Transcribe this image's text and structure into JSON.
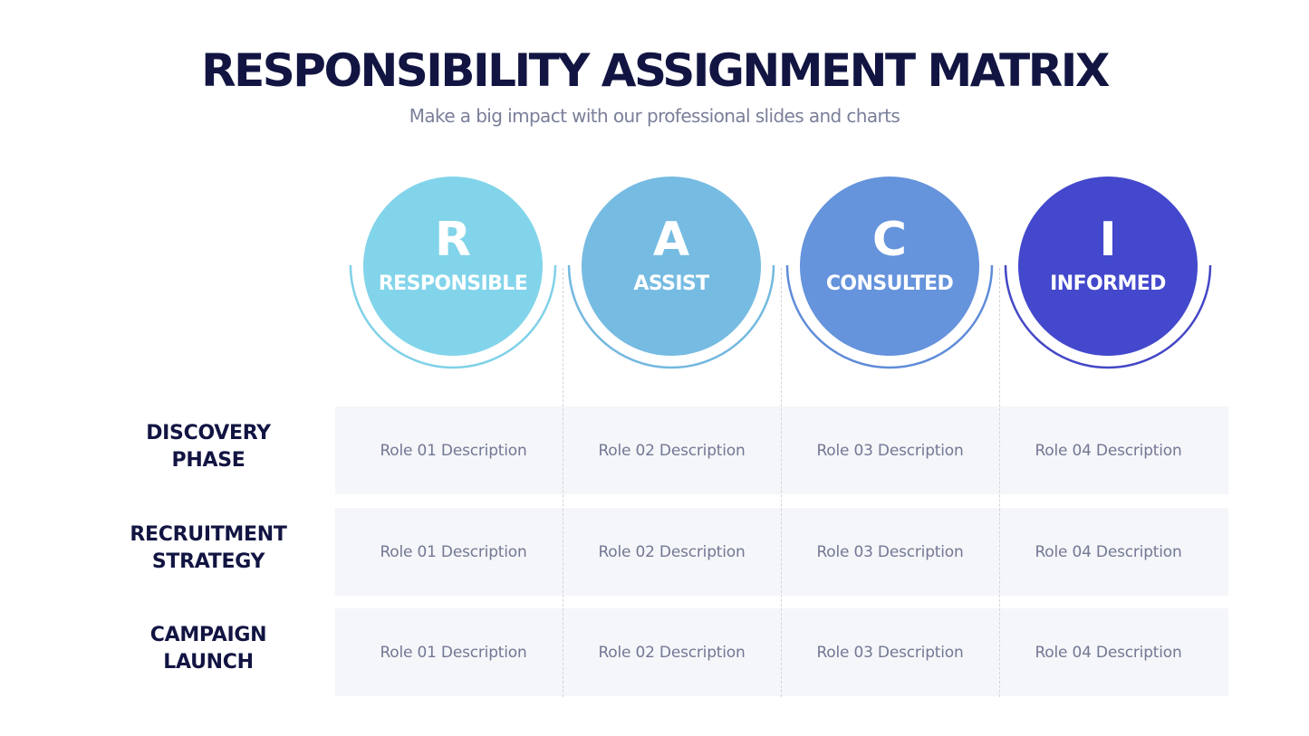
{
  "header": {
    "title": "RESPONSIBILITY ASSIGNMENT MATRIX",
    "subtitle": "Make a big impact with our professional slides and charts"
  },
  "columns": [
    {
      "letter": "R",
      "label": "RESPONSIBLE",
      "color": "#82d4ea",
      "ring_color": "#7fd1e8"
    },
    {
      "letter": "A",
      "label": "ASSIST",
      "color": "#76bbe2",
      "ring_color": "#73b8e0"
    },
    {
      "letter": "C",
      "label": "CONSULTED",
      "color": "#6593dc",
      "ring_color": "#5f8cd8"
    },
    {
      "letter": "I",
      "label": "INFORMED",
      "color": "#4348cc",
      "ring_color": "#4347c6"
    }
  ],
  "rows": [
    {
      "label_line1": "DISCOVERY",
      "label_line2": "PHASE",
      "cells": [
        "Role 01 Description",
        "Role 02 Description",
        "Role 03 Description",
        "Role 04 Description"
      ]
    },
    {
      "label_line1": "RECRUITMENT",
      "label_line2": "STRATEGY",
      "cells": [
        "Role 01 Description",
        "Role 02 Description",
        "Role 03 Description",
        "Role 04 Description"
      ]
    },
    {
      "label_line1": "CAMPAIGN",
      "label_line2": "LAUNCH",
      "cells": [
        "Role 01 Description",
        "Role 02 Description",
        "Role 03 Description",
        "Role 04 Description"
      ]
    }
  ],
  "colors": {
    "title": "#121542",
    "subtitle": "#7a7f9a",
    "cell_background": "#f4f6f9",
    "cell_text": "#737894"
  }
}
